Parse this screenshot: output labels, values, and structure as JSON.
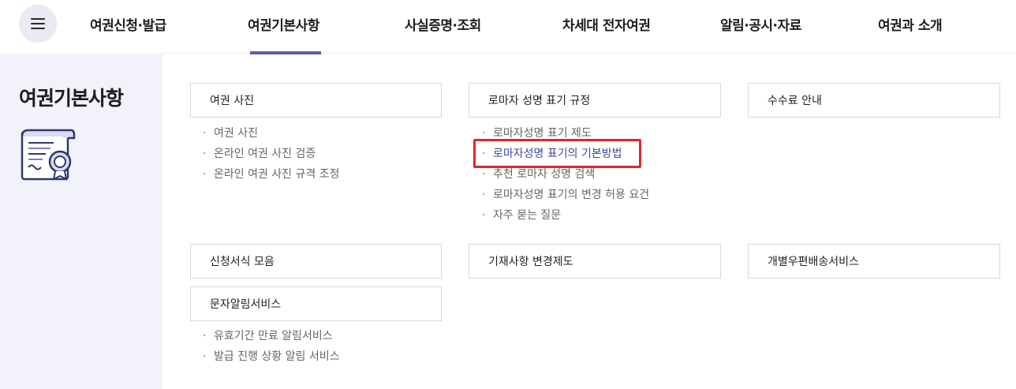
{
  "nav": {
    "menu_icon": "hamburger-menu-icon",
    "items": [
      "여권신청·발급",
      "여권기본사항",
      "사실증명·조회",
      "차세대 전자여권",
      "알림·공시·자료",
      "여권과 소개"
    ],
    "active_index": 1,
    "accent_color": "#5b5fa7"
  },
  "sidebar": {
    "title": "여권기본사항",
    "icon": "certificate-document-icon",
    "background": "#f2f2fb"
  },
  "sections": [
    {
      "title": "여권 사진",
      "items": [
        "여권 사진",
        "온라인 여권 사진 검증",
        "온라인 여권 사진 규격 조정"
      ]
    },
    {
      "title": "로마자 성명 표기 규정",
      "items": [
        "로마자성명 표기 제도",
        "로마자성명 표기의 기본방법",
        "추천 로마자 성명 검색",
        "로마자성명 표기의 변경 허용 요건",
        "자주 묻는 질문"
      ],
      "highlighted_item_index": 1,
      "highlight_color": "#e0262d"
    },
    {
      "title": "수수료 안내",
      "items": []
    },
    {
      "title": "신청서식 모음",
      "items": []
    },
    {
      "title": "기재사항 변경제도",
      "items": []
    },
    {
      "title": "개별우편배송서비스",
      "items": []
    },
    {
      "title": "문자알림서비스",
      "items": [
        "유효기간 만료 알림서비스",
        "발급 진행 상황 알림 서비스"
      ]
    }
  ]
}
